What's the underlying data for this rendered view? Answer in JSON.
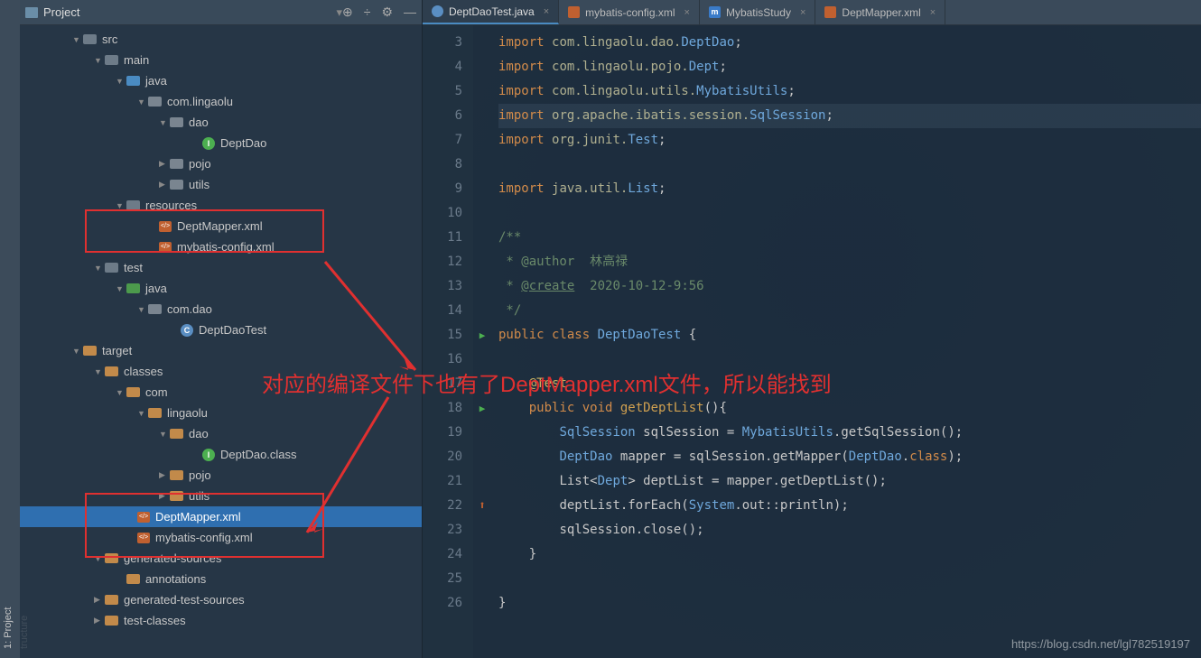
{
  "sideStrip": {
    "top": "1: Project",
    "bottom": "tructure"
  },
  "project": {
    "title": "Project",
    "tree": {
      "src": "src",
      "main": "main",
      "java": "java",
      "pkg": "com.lingaolu",
      "dao": "dao",
      "deptDao": "DeptDao",
      "pojo": "pojo",
      "utils": "utils",
      "resources": "resources",
      "deptMapperXml": "DeptMapper.xml",
      "mybatisConfig": "mybatis-config.xml",
      "test": "test",
      "testJava": "java",
      "comDao": "com.dao",
      "deptDaoTest": "DeptDaoTest",
      "target": "target",
      "classes": "classes",
      "com": "com",
      "lingaolu": "lingaolu",
      "dao2": "dao",
      "deptDaoClass": "DeptDao.class",
      "pojo2": "pojo",
      "utils2": "utils",
      "deptMapperXml2": "DeptMapper.xml",
      "mybatisConfig2": "mybatis-config.xml",
      "genSources": "generated-sources",
      "annotations": "annotations",
      "genTestSources": "generated-test-sources",
      "testClasses": "test-classes"
    }
  },
  "tabs": [
    {
      "label": "DeptDaoTest.java",
      "active": true,
      "kind": "java"
    },
    {
      "label": "mybatis-config.xml",
      "active": false,
      "kind": "xml"
    },
    {
      "label": "MybatisStudy",
      "active": false,
      "kind": "m"
    },
    {
      "label": "DeptMapper.xml",
      "active": false,
      "kind": "xml"
    }
  ],
  "annotation": "对应的编译文件下也有了DeptMapper.xml文件，所以能找到",
  "watermark": "https://blog.csdn.net/lgl782519197",
  "code": {
    "startLine": 3,
    "lines": [
      {
        "n": 3,
        "t": "import ",
        "p": "com.lingaolu.dao.",
        "c": "DeptDao",
        "e": ";"
      },
      {
        "n": 4,
        "t": "import ",
        "p": "com.lingaolu.pojo.",
        "c": "Dept",
        "e": ";"
      },
      {
        "n": 5,
        "t": "import ",
        "p": "com.lingaolu.utils.",
        "c": "MybatisUtils",
        "e": ";"
      },
      {
        "n": 6,
        "hl": true,
        "t": "import ",
        "p": "org.apache.ibatis.session.",
        "c": "SqlSession",
        "e": ";"
      },
      {
        "n": 7,
        "t": "import ",
        "p": "org.junit.",
        "c": "Test",
        "e": ";"
      },
      {
        "n": 8,
        "blank": true
      },
      {
        "n": 9,
        "t": "import ",
        "p": "java.util.",
        "c": "List",
        "e": ";"
      },
      {
        "n": 10,
        "blank": true
      },
      {
        "n": 11,
        "raw": "/**",
        "cls": "com"
      },
      {
        "n": 12,
        "raw": " * @author  林高禄",
        "cls": "com"
      },
      {
        "n": 13,
        "rawHtml": " * <span class='under'>@create</span>  2020-10-12-9:56",
        "cls": "com"
      },
      {
        "n": 14,
        "raw": " */",
        "cls": "com"
      },
      {
        "n": 15,
        "run": true,
        "html": "<span class='kw'>public class </span><span class='cls'>DeptDaoTest</span> <span class='pun'>{</span>"
      },
      {
        "n": 16,
        "blank": true
      },
      {
        "n": 17,
        "indent": 1,
        "html": "<span class='fn2'>@Test</span>"
      },
      {
        "n": 18,
        "run": true,
        "indent": 1,
        "html": "<span class='kw'>public void </span><span class='fn'>getDeptList</span><span class='pun'>(){</span>"
      },
      {
        "n": 19,
        "indent": 2,
        "html": "<span class='cls'>SqlSession</span> <span class='var'>sqlSession = </span><span class='cls'>MybatisUtils</span><span class='pun'>.</span><span class='var'>getSqlSession();</span>"
      },
      {
        "n": 20,
        "indent": 2,
        "html": "<span class='cls'>DeptDao</span> <span class='var'>mapper = sqlSession.getMapper(</span><span class='cls'>DeptDao</span><span class='pun'>.</span><span class='kw'>class</span><span class='pun'>);</span>"
      },
      {
        "n": 21,
        "indent": 2,
        "html": "<span class='var'>List&lt;</span><span class='cls'>Dept</span><span class='var'>&gt; deptList = mapper.getDeptList();</span>"
      },
      {
        "n": 22,
        "up": true,
        "indent": 2,
        "html": "<span class='var'>deptList.forEach(</span><span class='cls'>System</span><span class='pun'>.</span><span class='var'>out::println);</span>"
      },
      {
        "n": 23,
        "indent": 2,
        "html": "<span class='var'>sqlSession.close();</span>"
      },
      {
        "n": 24,
        "indent": 1,
        "html": "<span class='pun'>}</span>"
      },
      {
        "n": 25,
        "blank": true
      },
      {
        "n": 26,
        "html": "<span class='pun'>}</span>"
      }
    ]
  }
}
